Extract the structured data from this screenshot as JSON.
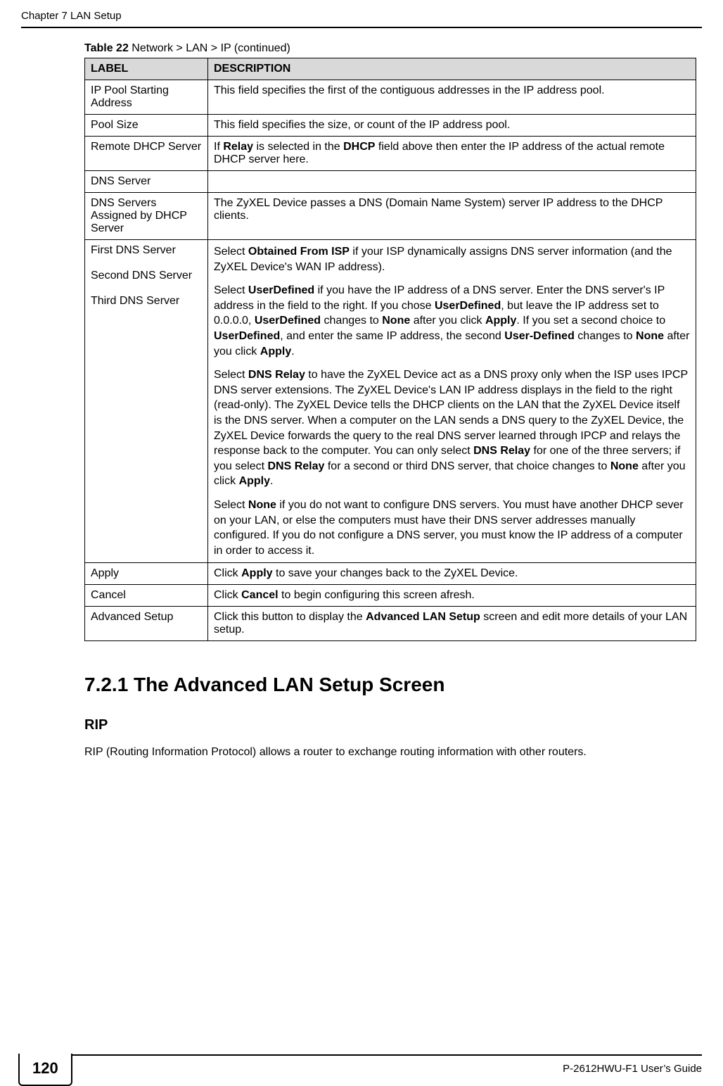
{
  "header": {
    "chapter": "Chapter 7 LAN Setup"
  },
  "table": {
    "caption_prefix": "Table 22",
    "caption_rest": "   Network > LAN > IP (continued)",
    "headers": {
      "label": "LABEL",
      "description": "DESCRIPTION"
    },
    "rows": [
      {
        "label": "IP Pool Starting Address",
        "desc": "This field specifies the first of the contiguous addresses in the IP address pool."
      },
      {
        "label": "Pool Size",
        "desc": "This field specifies the size, or count of the IP address pool."
      },
      {
        "label": "Remote DHCP Server",
        "desc_html": "If <b>Relay</b> is selected in the <b>DHCP</b> field above then enter the IP address of the actual remote DHCP server here."
      },
      {
        "label": "DNS Server",
        "desc": ""
      },
      {
        "label": "DNS Servers Assigned by DHCP Server",
        "desc": "The ZyXEL Device passes a DNS (Domain Name System) server IP address to the DHCP clients."
      },
      {
        "label_html": "First DNS Server<br><br>Second DNS Server<br><br>Third DNS Server",
        "desc_paras": [
          "Select <b>Obtained From ISP</b> if your ISP dynamically assigns DNS server information (and the ZyXEL Device's WAN IP address).",
          "Select <b>UserDefined</b> if you have the IP address of a DNS server. Enter the DNS server's IP address in the field to the right. If you chose <b>UserDefined</b>, but leave the IP address set to 0.0.0.0, <b>UserDefined</b> changes to <b>None</b> after you click <b>Apply</b>. If you set a second choice to <b>UserDefined</b>, and enter the same IP address, the second <b>User-Defined</b> changes to <b>None</b> after you click <b>Apply</b>.",
          "Select <b>DNS Relay</b> to have the ZyXEL Device act as a DNS proxy only when the ISP uses IPCP DNS server extensions. The ZyXEL Device's LAN IP address displays in the field to the right (read-only). The ZyXEL Device tells the DHCP clients on the LAN that the ZyXEL Device itself is the DNS server. When a computer on the LAN sends a DNS query to the ZyXEL Device, the ZyXEL Device forwards the query to the real DNS server learned through IPCP and relays the response back to the computer. You can only select <b>DNS Relay</b> for one of the three servers; if you select <b>DNS Relay</b> for a second or third DNS server, that choice changes to <b>None</b> after you click <b>Apply</b>.",
          "Select <b>None</b> if you do not want to configure DNS servers. You must have another DHCP sever on your LAN, or else the computers must have their DNS server addresses manually configured. If you do not configure a DNS server, you must know the IP address of a computer in order to access it."
        ]
      },
      {
        "label": "Apply",
        "desc_html": "Click <b>Apply</b> to save your changes back to the ZyXEL Device."
      },
      {
        "label": "Cancel",
        "desc_html": "Click <b>Cancel</b> to begin configuring this screen afresh."
      },
      {
        "label": "Advanced Setup",
        "desc_html": "Click this button to display the <b>Advanced LAN Setup</b> screen and edit more details of your LAN setup."
      }
    ]
  },
  "section": {
    "heading": "7.2.1  The Advanced LAN Setup Screen",
    "subheading": "RIP",
    "body": "RIP (Routing Information Protocol) allows a router to exchange routing information with other routers."
  },
  "footer": {
    "page_number": "120",
    "guide": "P-2612HWU-F1 User’s Guide"
  }
}
